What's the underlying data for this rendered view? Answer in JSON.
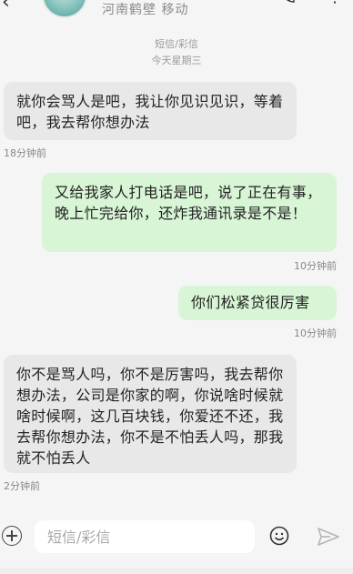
{
  "header": {
    "location": "河南鹤壁 移动"
  },
  "thread": {
    "channel": "短信/彩信",
    "day": "今天星期三"
  },
  "messages": [
    {
      "dir": "in",
      "text": "就你会骂人是吧，我让你见识见识，等着吧，我去帮你想办法",
      "time": "18分钟前"
    },
    {
      "dir": "out",
      "text": "又给我家人打电话是吧，说了正在有事，晚上忙完给你，还炸我通讯录是不是！",
      "time": "10分钟前"
    },
    {
      "dir": "out",
      "text": "你们松紧贷很厉害",
      "time": "10分钟前"
    },
    {
      "dir": "in",
      "text": "你不是骂人吗，你不是厉害吗，我去帮你想办法，公司是你家的啊，你说啥时候就啥时候啊，这几百块钱，你爱还不还，我去帮你想办法，你不是不怕丢人吗，那我就不怕丢人",
      "time": "2分钟前"
    }
  ],
  "composer": {
    "placeholder": "短信/彩信"
  }
}
